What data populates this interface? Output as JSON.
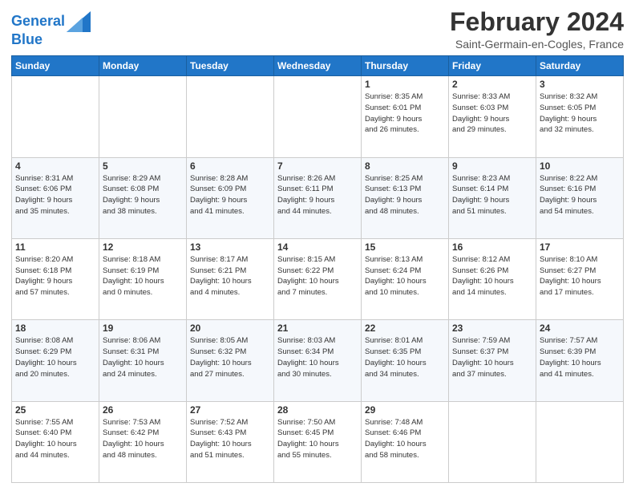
{
  "logo": {
    "line1": "General",
    "line2": "Blue"
  },
  "header": {
    "month": "February 2024",
    "location": "Saint-Germain-en-Cogles, France"
  },
  "columns": [
    "Sunday",
    "Monday",
    "Tuesday",
    "Wednesday",
    "Thursday",
    "Friday",
    "Saturday"
  ],
  "weeks": [
    [
      {
        "day": "",
        "info": ""
      },
      {
        "day": "",
        "info": ""
      },
      {
        "day": "",
        "info": ""
      },
      {
        "day": "",
        "info": ""
      },
      {
        "day": "1",
        "info": "Sunrise: 8:35 AM\nSunset: 6:01 PM\nDaylight: 9 hours\nand 26 minutes."
      },
      {
        "day": "2",
        "info": "Sunrise: 8:33 AM\nSunset: 6:03 PM\nDaylight: 9 hours\nand 29 minutes."
      },
      {
        "day": "3",
        "info": "Sunrise: 8:32 AM\nSunset: 6:05 PM\nDaylight: 9 hours\nand 32 minutes."
      }
    ],
    [
      {
        "day": "4",
        "info": "Sunrise: 8:31 AM\nSunset: 6:06 PM\nDaylight: 9 hours\nand 35 minutes."
      },
      {
        "day": "5",
        "info": "Sunrise: 8:29 AM\nSunset: 6:08 PM\nDaylight: 9 hours\nand 38 minutes."
      },
      {
        "day": "6",
        "info": "Sunrise: 8:28 AM\nSunset: 6:09 PM\nDaylight: 9 hours\nand 41 minutes."
      },
      {
        "day": "7",
        "info": "Sunrise: 8:26 AM\nSunset: 6:11 PM\nDaylight: 9 hours\nand 44 minutes."
      },
      {
        "day": "8",
        "info": "Sunrise: 8:25 AM\nSunset: 6:13 PM\nDaylight: 9 hours\nand 48 minutes."
      },
      {
        "day": "9",
        "info": "Sunrise: 8:23 AM\nSunset: 6:14 PM\nDaylight: 9 hours\nand 51 minutes."
      },
      {
        "day": "10",
        "info": "Sunrise: 8:22 AM\nSunset: 6:16 PM\nDaylight: 9 hours\nand 54 minutes."
      }
    ],
    [
      {
        "day": "11",
        "info": "Sunrise: 8:20 AM\nSunset: 6:18 PM\nDaylight: 9 hours\nand 57 minutes."
      },
      {
        "day": "12",
        "info": "Sunrise: 8:18 AM\nSunset: 6:19 PM\nDaylight: 10 hours\nand 0 minutes."
      },
      {
        "day": "13",
        "info": "Sunrise: 8:17 AM\nSunset: 6:21 PM\nDaylight: 10 hours\nand 4 minutes."
      },
      {
        "day": "14",
        "info": "Sunrise: 8:15 AM\nSunset: 6:22 PM\nDaylight: 10 hours\nand 7 minutes."
      },
      {
        "day": "15",
        "info": "Sunrise: 8:13 AM\nSunset: 6:24 PM\nDaylight: 10 hours\nand 10 minutes."
      },
      {
        "day": "16",
        "info": "Sunrise: 8:12 AM\nSunset: 6:26 PM\nDaylight: 10 hours\nand 14 minutes."
      },
      {
        "day": "17",
        "info": "Sunrise: 8:10 AM\nSunset: 6:27 PM\nDaylight: 10 hours\nand 17 minutes."
      }
    ],
    [
      {
        "day": "18",
        "info": "Sunrise: 8:08 AM\nSunset: 6:29 PM\nDaylight: 10 hours\nand 20 minutes."
      },
      {
        "day": "19",
        "info": "Sunrise: 8:06 AM\nSunset: 6:31 PM\nDaylight: 10 hours\nand 24 minutes."
      },
      {
        "day": "20",
        "info": "Sunrise: 8:05 AM\nSunset: 6:32 PM\nDaylight: 10 hours\nand 27 minutes."
      },
      {
        "day": "21",
        "info": "Sunrise: 8:03 AM\nSunset: 6:34 PM\nDaylight: 10 hours\nand 30 minutes."
      },
      {
        "day": "22",
        "info": "Sunrise: 8:01 AM\nSunset: 6:35 PM\nDaylight: 10 hours\nand 34 minutes."
      },
      {
        "day": "23",
        "info": "Sunrise: 7:59 AM\nSunset: 6:37 PM\nDaylight: 10 hours\nand 37 minutes."
      },
      {
        "day": "24",
        "info": "Sunrise: 7:57 AM\nSunset: 6:39 PM\nDaylight: 10 hours\nand 41 minutes."
      }
    ],
    [
      {
        "day": "25",
        "info": "Sunrise: 7:55 AM\nSunset: 6:40 PM\nDaylight: 10 hours\nand 44 minutes."
      },
      {
        "day": "26",
        "info": "Sunrise: 7:53 AM\nSunset: 6:42 PM\nDaylight: 10 hours\nand 48 minutes."
      },
      {
        "day": "27",
        "info": "Sunrise: 7:52 AM\nSunset: 6:43 PM\nDaylight: 10 hours\nand 51 minutes."
      },
      {
        "day": "28",
        "info": "Sunrise: 7:50 AM\nSunset: 6:45 PM\nDaylight: 10 hours\nand 55 minutes."
      },
      {
        "day": "29",
        "info": "Sunrise: 7:48 AM\nSunset: 6:46 PM\nDaylight: 10 hours\nand 58 minutes."
      },
      {
        "day": "",
        "info": ""
      },
      {
        "day": "",
        "info": ""
      }
    ]
  ]
}
